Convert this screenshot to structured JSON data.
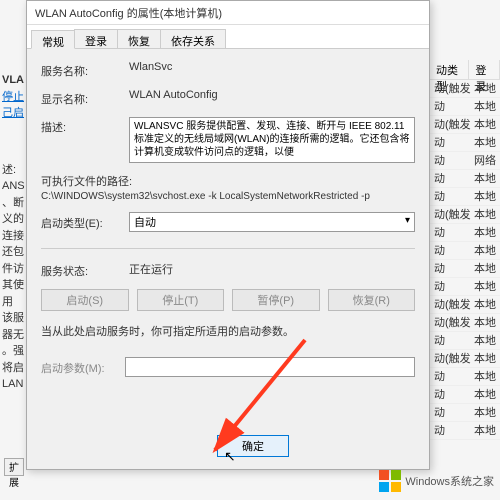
{
  "dialog": {
    "title": "WLAN AutoConfig 的属性(本地计算机)",
    "tabs": [
      "常规",
      "登录",
      "恢复",
      "依存关系"
    ],
    "serviceName": {
      "label": "服务名称:",
      "value": "WlanSvc"
    },
    "displayName": {
      "label": "显示名称:",
      "value": "WLAN AutoConfig"
    },
    "description": {
      "label": "描述:",
      "value": "WLANSVC 服务提供配置、发现、连接、断开与 IEEE 802.11 标准定义的无线局域网(WLAN)的连接所需的逻辑。它还包含将计算机变成软件访问点的逻辑，以便"
    },
    "execPath": {
      "label": "可执行文件的路径:",
      "value": "C:\\WINDOWS\\system32\\svchost.exe -k LocalSystemNetworkRestricted -p"
    },
    "startupType": {
      "label": "启动类型(E):",
      "value": "自动"
    },
    "status": {
      "label": "服务状态:",
      "value": "正在运行"
    },
    "buttons": {
      "start": "启动(S)",
      "stop": "停止(T)",
      "pause": "暂停(P)",
      "resume": "恢复(R)"
    },
    "note": "当从此处启动服务时，你可指定所适用的启动参数。",
    "startParams": {
      "label": "启动参数(M):",
      "value": ""
    },
    "ok": "确定"
  },
  "bg": {
    "leftHeader": "VLA",
    "leftDesc": "停止\n己启",
    "leftText": "述:\nANS\n、断\n义的\n连接\n还包\n件访\n其使用\n该服\n器无\n。强\n将启\nLAN",
    "colA": "动类型",
    "colB": "登录",
    "rows": [
      [
        "动(触发",
        "本地"
      ],
      [
        "动",
        "本地"
      ],
      [
        "动(触发",
        "本地"
      ],
      [
        "动",
        "本地"
      ],
      [
        "动",
        "网络"
      ],
      [
        "动",
        "本地"
      ],
      [
        "动",
        "本地"
      ],
      [
        "动(触发",
        "本地"
      ],
      [
        "动",
        "本地"
      ],
      [
        "动",
        "本地"
      ],
      [
        "动",
        "本地"
      ],
      [
        "动",
        "本地"
      ],
      [
        "动(触发",
        "本地"
      ],
      [
        "动(触发",
        "本地"
      ],
      [
        "动",
        "本地"
      ],
      [
        "动(触发",
        "本地"
      ],
      [
        "动",
        "本地"
      ],
      [
        "动",
        "本地"
      ],
      [
        "动",
        "本地"
      ],
      [
        "动",
        "本地"
      ]
    ],
    "expand": "扩展"
  },
  "watermark": "Windows系统之家"
}
